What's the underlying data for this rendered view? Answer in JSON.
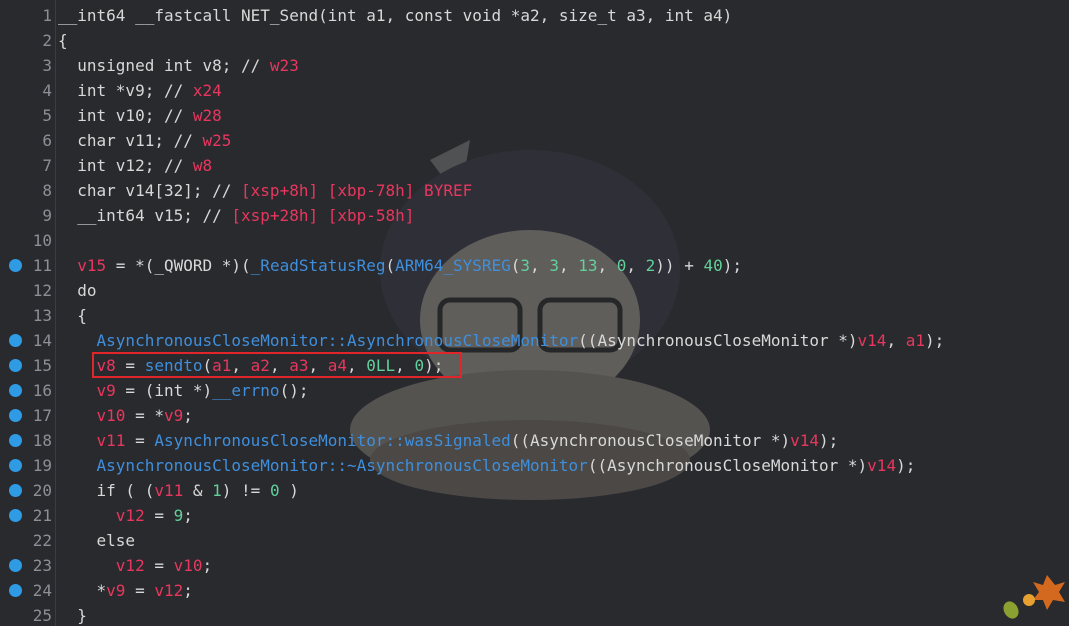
{
  "editor": {
    "lines": [
      {
        "n": "1",
        "bp": false,
        "parts": [
          [
            "t",
            "__int64 __fastcall NET_Send(int a1, const void *a2, size_t a3, int a4)"
          ]
        ]
      },
      {
        "n": "2",
        "bp": false,
        "parts": [
          [
            "t",
            "{"
          ]
        ]
      },
      {
        "n": "3",
        "bp": false,
        "parts": [
          [
            "t",
            "  unsigned int v8; // "
          ],
          [
            "r",
            "w23"
          ]
        ]
      },
      {
        "n": "4",
        "bp": false,
        "parts": [
          [
            "t",
            "  int *v9; // "
          ],
          [
            "r",
            "x24"
          ]
        ]
      },
      {
        "n": "5",
        "bp": false,
        "parts": [
          [
            "t",
            "  int v10; // "
          ],
          [
            "r",
            "w28"
          ]
        ]
      },
      {
        "n": "6",
        "bp": false,
        "parts": [
          [
            "t",
            "  char v11; // "
          ],
          [
            "r",
            "w25"
          ]
        ]
      },
      {
        "n": "7",
        "bp": false,
        "parts": [
          [
            "t",
            "  int v12; // "
          ],
          [
            "r",
            "w8"
          ]
        ]
      },
      {
        "n": "8",
        "bp": false,
        "parts": [
          [
            "t",
            "  char v14[32]; // "
          ],
          [
            "r",
            "[xsp+8h] [xbp-78h] BYREF"
          ]
        ]
      },
      {
        "n": "9",
        "bp": false,
        "parts": [
          [
            "t",
            "  __int64 v15; // "
          ],
          [
            "r",
            "[xsp+28h] [xbp-58h]"
          ]
        ]
      },
      {
        "n": "10",
        "bp": false,
        "parts": [
          [
            "t",
            ""
          ]
        ]
      },
      {
        "n": "11",
        "bp": true,
        "parts": [
          [
            "t",
            "  "
          ],
          [
            "v",
            "v15"
          ],
          [
            "t",
            " = *(_QWORD *)("
          ],
          [
            "f",
            "_ReadStatusReg"
          ],
          [
            "t",
            "("
          ],
          [
            "f",
            "ARM64_SYSREG"
          ],
          [
            "t",
            "("
          ],
          [
            "n",
            "3"
          ],
          [
            "t",
            ", "
          ],
          [
            "n",
            "3"
          ],
          [
            "t",
            ", "
          ],
          [
            "n",
            "13"
          ],
          [
            "t",
            ", "
          ],
          [
            "n",
            "0"
          ],
          [
            "t",
            ", "
          ],
          [
            "n",
            "2"
          ],
          [
            "t",
            ")) + "
          ],
          [
            "n",
            "40"
          ],
          [
            "t",
            ");"
          ]
        ]
      },
      {
        "n": "12",
        "bp": false,
        "parts": [
          [
            "t",
            "  do"
          ]
        ]
      },
      {
        "n": "13",
        "bp": false,
        "parts": [
          [
            "t",
            "  {"
          ]
        ]
      },
      {
        "n": "14",
        "bp": true,
        "parts": [
          [
            "t",
            "    "
          ],
          [
            "f",
            "AsynchronousCloseMonitor::AsynchronousCloseMonitor"
          ],
          [
            "t",
            "((AsynchronousCloseMonitor *)"
          ],
          [
            "v",
            "v14"
          ],
          [
            "t",
            ", "
          ],
          [
            "v",
            "a1"
          ],
          [
            "t",
            ");"
          ]
        ]
      },
      {
        "n": "15",
        "bp": true,
        "parts": [
          [
            "t",
            "    "
          ],
          [
            "v",
            "v8"
          ],
          [
            "t",
            " = "
          ],
          [
            "f",
            "sendto"
          ],
          [
            "t",
            "("
          ],
          [
            "v",
            "a1"
          ],
          [
            "t",
            ", "
          ],
          [
            "v",
            "a2"
          ],
          [
            "t",
            ", "
          ],
          [
            "v",
            "a3"
          ],
          [
            "t",
            ", "
          ],
          [
            "v",
            "a4"
          ],
          [
            "t",
            ", "
          ],
          [
            "n",
            "0LL"
          ],
          [
            "t",
            ", "
          ],
          [
            "n",
            "0"
          ],
          [
            "t",
            ");"
          ]
        ]
      },
      {
        "n": "16",
        "bp": true,
        "parts": [
          [
            "t",
            "    "
          ],
          [
            "v",
            "v9"
          ],
          [
            "t",
            " = (int *)"
          ],
          [
            "f",
            "__errno"
          ],
          [
            "t",
            "();"
          ]
        ]
      },
      {
        "n": "17",
        "bp": true,
        "parts": [
          [
            "t",
            "    "
          ],
          [
            "v",
            "v10"
          ],
          [
            "t",
            " = *"
          ],
          [
            "v",
            "v9"
          ],
          [
            "t",
            ";"
          ]
        ]
      },
      {
        "n": "18",
        "bp": true,
        "parts": [
          [
            "t",
            "    "
          ],
          [
            "v",
            "v11"
          ],
          [
            "t",
            " = "
          ],
          [
            "f",
            "AsynchronousCloseMonitor::wasSignaled"
          ],
          [
            "t",
            "((AsynchronousCloseMonitor *)"
          ],
          [
            "v",
            "v14"
          ],
          [
            "t",
            ");"
          ]
        ]
      },
      {
        "n": "19",
        "bp": true,
        "parts": [
          [
            "t",
            "    "
          ],
          [
            "f",
            "AsynchronousCloseMonitor::~AsynchronousCloseMonitor"
          ],
          [
            "t",
            "((AsynchronousCloseMonitor *)"
          ],
          [
            "v",
            "v14"
          ],
          [
            "t",
            ");"
          ]
        ]
      },
      {
        "n": "20",
        "bp": true,
        "parts": [
          [
            "t",
            "    if ( ("
          ],
          [
            "v",
            "v11"
          ],
          [
            "t",
            " & "
          ],
          [
            "n",
            "1"
          ],
          [
            "t",
            ") != "
          ],
          [
            "n",
            "0"
          ],
          [
            "t",
            " )"
          ]
        ]
      },
      {
        "n": "21",
        "bp": true,
        "parts": [
          [
            "t",
            "      "
          ],
          [
            "v",
            "v12"
          ],
          [
            "t",
            " = "
          ],
          [
            "n",
            "9"
          ],
          [
            "t",
            ";"
          ]
        ]
      },
      {
        "n": "22",
        "bp": false,
        "parts": [
          [
            "t",
            "    else"
          ]
        ]
      },
      {
        "n": "23",
        "bp": true,
        "parts": [
          [
            "t",
            "      "
          ],
          [
            "v",
            "v12"
          ],
          [
            "t",
            " = "
          ],
          [
            "v",
            "v10"
          ],
          [
            "t",
            ";"
          ]
        ]
      },
      {
        "n": "24",
        "bp": true,
        "parts": [
          [
            "t",
            "    *"
          ],
          [
            "v",
            "v9"
          ],
          [
            "t",
            " = "
          ],
          [
            "v",
            "v12"
          ],
          [
            "t",
            ";"
          ]
        ]
      },
      {
        "n": "25",
        "bp": false,
        "parts": [
          [
            "t",
            "  }"
          ]
        ]
      }
    ],
    "highlighted_line": "15"
  },
  "colors": {
    "background": "#292a2e",
    "text": "#d8d8d8",
    "register_comment": "#e8375e",
    "variable": "#e8375e",
    "function": "#3f8fdc",
    "number": "#62d09a",
    "breakpoint": "#2f9be4",
    "highlight_box": "#e0262b"
  }
}
